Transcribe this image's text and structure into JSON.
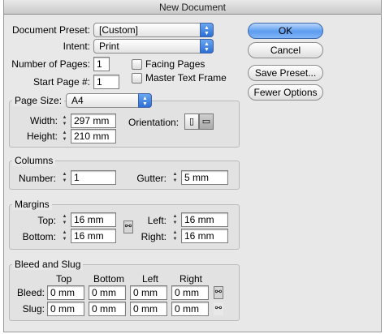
{
  "window": {
    "title": "New Document"
  },
  "buttons": {
    "ok": "OK",
    "cancel": "Cancel",
    "save_preset": "Save Preset...",
    "fewer_options": "Fewer Options"
  },
  "document": {
    "preset_label": "Document Preset:",
    "preset_value": "[Custom]",
    "intent_label": "Intent:",
    "intent_value": "Print",
    "num_pages_label": "Number of Pages:",
    "num_pages_value": "1",
    "start_page_label": "Start Page #:",
    "start_page_value": "1",
    "facing_pages_label": "Facing Pages",
    "master_text_frame_label": "Master Text Frame"
  },
  "page_size": {
    "label": "Page Size:",
    "value": "A4",
    "width_label": "Width:",
    "width_value": "297 mm",
    "height_label": "Height:",
    "height_value": "210 mm",
    "orientation_label": "Orientation:"
  },
  "columns": {
    "title": "Columns",
    "number_label": "Number:",
    "number_value": "1",
    "gutter_label": "Gutter:",
    "gutter_value": "5 mm"
  },
  "margins": {
    "title": "Margins",
    "top_label": "Top:",
    "top_value": "16 mm",
    "bottom_label": "Bottom:",
    "bottom_value": "16 mm",
    "left_label": "Left:",
    "left_value": "16 mm",
    "right_label": "Right:",
    "right_value": "16 mm"
  },
  "bleed_slug": {
    "title": "Bleed and Slug",
    "col_top": "Top",
    "col_bottom": "Bottom",
    "col_left": "Left",
    "col_right": "Right",
    "bleed_label": "Bleed:",
    "slug_label": "Slug:",
    "bleed_top": "0 mm",
    "bleed_bottom": "0 mm",
    "bleed_left": "0 mm",
    "bleed_right": "0 mm",
    "slug_top": "0 mm",
    "slug_bottom": "0 mm",
    "slug_left": "0 mm",
    "slug_right": "0 mm"
  }
}
